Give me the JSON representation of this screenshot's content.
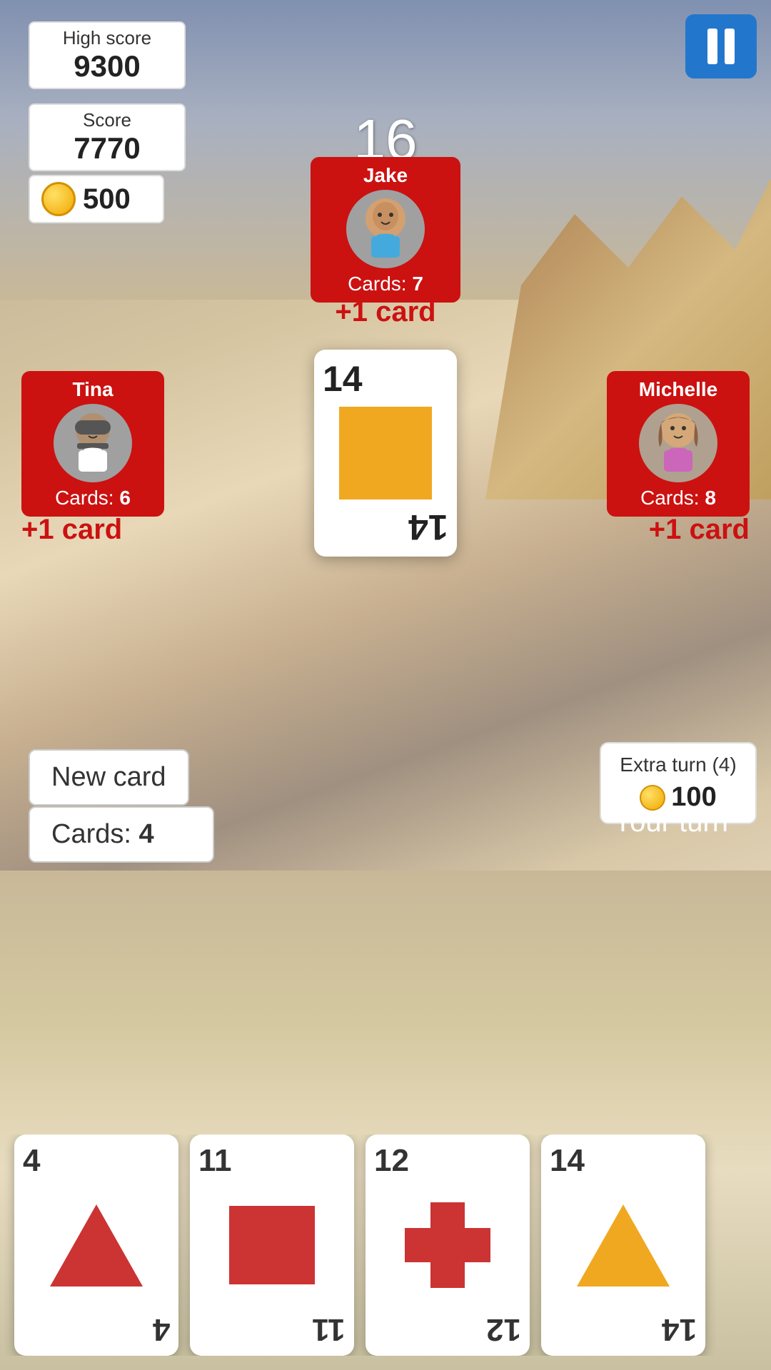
{
  "scores": {
    "high_score_label": "High score",
    "high_score_value": "9300",
    "score_label": "Score",
    "score_value": "7770",
    "coins": "500"
  },
  "turn": {
    "counter": "16"
  },
  "players": {
    "jake": {
      "name": "Jake",
      "cards_label": "Cards:",
      "cards_count": "7",
      "plus_card": "+1 card"
    },
    "tina": {
      "name": "Tina",
      "cards_label": "Cards:",
      "cards_count": "6",
      "plus_card": "+1 card"
    },
    "michelle": {
      "name": "Michelle",
      "cards_label": "Cards:",
      "cards_count": "8",
      "plus_card": "+1 card"
    }
  },
  "center_card": {
    "number": "14"
  },
  "controls": {
    "new_card_label": "New card",
    "player_cards_label": "Cards:",
    "player_cards_count": "4",
    "extra_turn_label": "Extra turn (4)",
    "extra_turn_cost": "100",
    "your_turn_label": "Your turn"
  },
  "hand": {
    "cards": [
      {
        "number": "4",
        "shape": "triangle"
      },
      {
        "number": "11",
        "shape": "square"
      },
      {
        "number": "12",
        "shape": "cross"
      },
      {
        "number": "14",
        "shape": "triangle-partial"
      }
    ]
  },
  "buttons": {
    "pause_label": "||"
  }
}
